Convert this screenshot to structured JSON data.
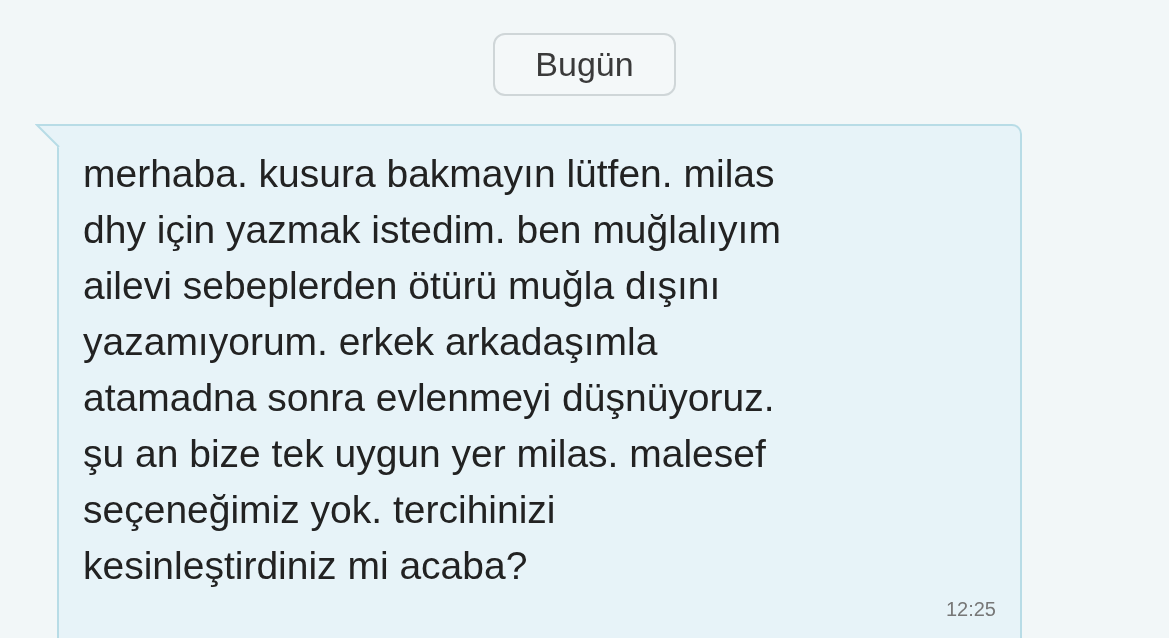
{
  "date_separator": "Bugün",
  "message": {
    "lines": [
      "merhaba. kusura bakmayın lütfen. milas",
      "dhy için yazmak istedim. ben muğlalıyım",
      "ailevi sebeplerden ötürü muğla dışını",
      "yazamıyorum. erkek arkadaşımla",
      "atamadna sonra evlenmeyi düşnüyoruz.",
      "şu an bize tek uygun yer milas. malesef",
      "seçeneğimiz yok. tercihinizi",
      "kesinleştirdiniz mi acaba?"
    ],
    "time": "12:25"
  }
}
